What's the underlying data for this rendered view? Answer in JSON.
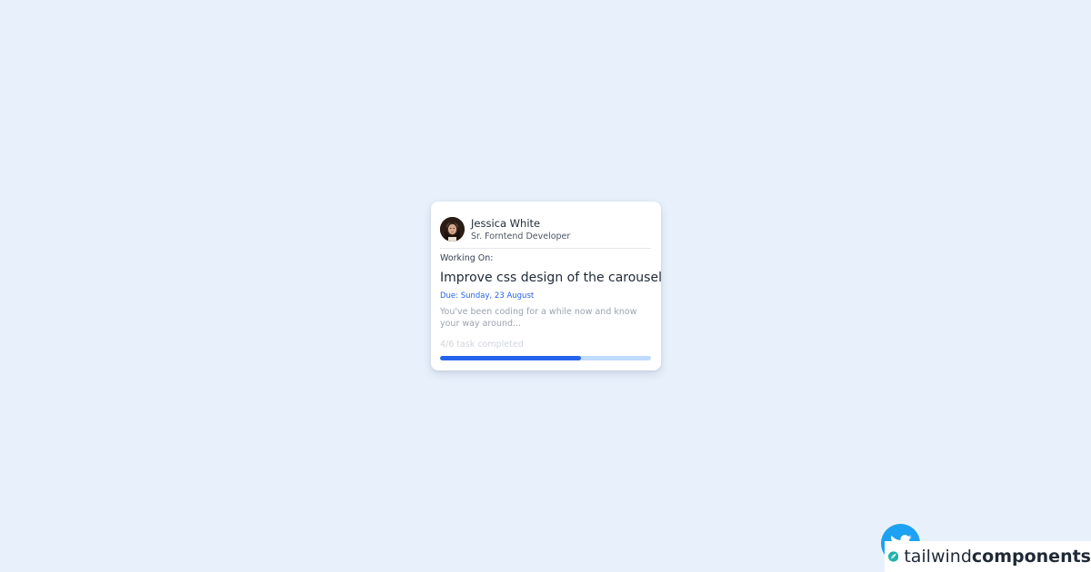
{
  "card": {
    "name": "Jessica White",
    "role": "Sr. Forntend Developer",
    "working_label": "Working On:",
    "task_title": "Improve css design of the carousel",
    "due": "Due: Sunday, 23 August",
    "description": "You've been coding for a while now and know your way around...",
    "progress_text": "4/6 task completed",
    "progress": {
      "done": 4,
      "total": 6
    }
  },
  "footer": {
    "brand_light": "tailwind",
    "brand_bold": "components"
  },
  "icons": {
    "avatar": "user-avatar",
    "twitter": "twitter-icon",
    "brand_logo": "tailwind-leaf-icon"
  },
  "colors": {
    "background": "#e8f1fb",
    "accent": "#2563eb",
    "progress_track": "#bfdbfe",
    "twitter": "#1da1f2",
    "brand": "#20b2aa"
  }
}
